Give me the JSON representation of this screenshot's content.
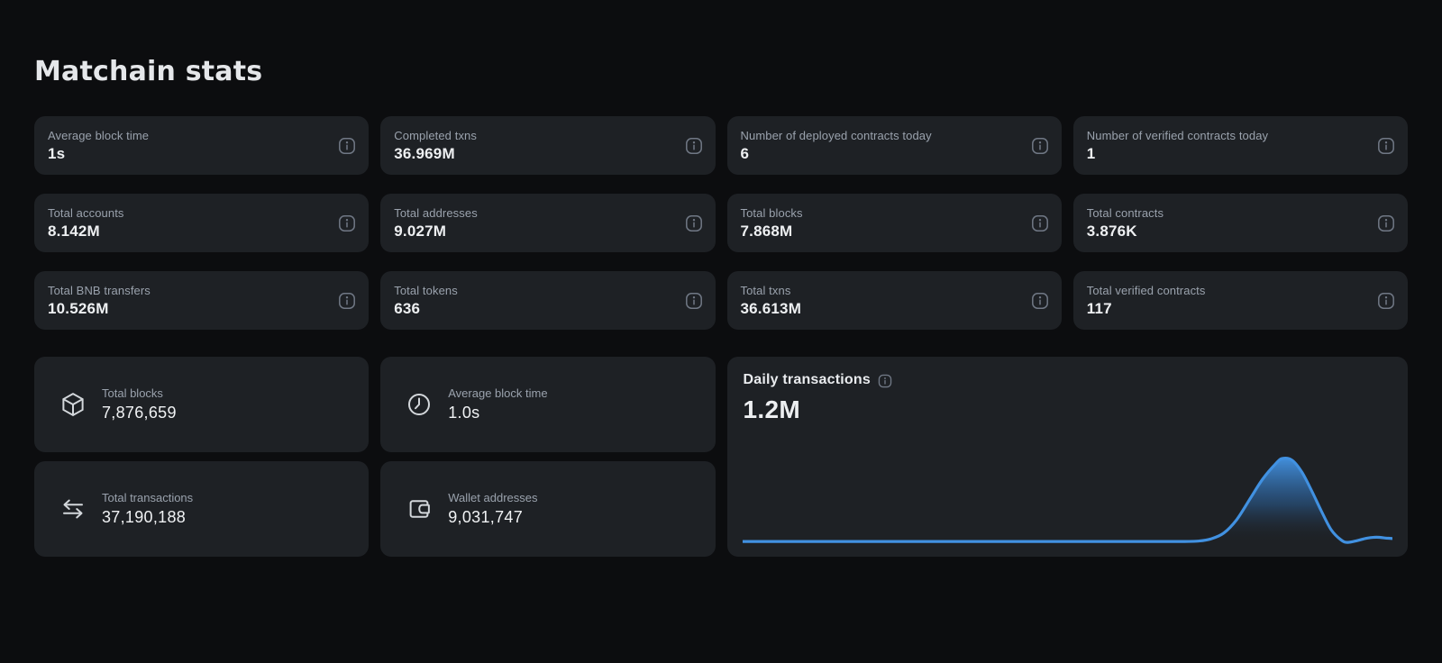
{
  "page": {
    "title": "Matchain stats"
  },
  "colors": {
    "background": "#0c0d0f",
    "card": "#1e2125",
    "accent_blue": "#4191e1",
    "label_gray": "#9aa2ad",
    "value_white": "#eef0f2"
  },
  "stat_cards": [
    {
      "label": "Average block time",
      "value": "1s"
    },
    {
      "label": "Completed txns",
      "value": "36.969M"
    },
    {
      "label": "Number of deployed contracts today",
      "value": "6"
    },
    {
      "label": "Number of verified contracts today",
      "value": "1"
    },
    {
      "label": "Total accounts",
      "value": "8.142M"
    },
    {
      "label": "Total addresses",
      "value": "9.027M"
    },
    {
      "label": "Total blocks",
      "value": "7.868M"
    },
    {
      "label": "Total contracts",
      "value": "3.876K"
    },
    {
      "label": "Total BNB transfers",
      "value": "10.526M"
    },
    {
      "label": "Total tokens",
      "value": "636"
    },
    {
      "label": "Total txns",
      "value": "36.613M"
    },
    {
      "label": "Total verified contracts",
      "value": "117"
    }
  ],
  "big_cards": [
    {
      "icon": "cube-icon",
      "label": "Total blocks",
      "value": "7,876,659"
    },
    {
      "icon": "clock-icon",
      "label": "Average block time",
      "value": "1.0s"
    },
    {
      "icon": "swap-arrows-icon",
      "label": "Total transactions",
      "value": "37,190,188"
    },
    {
      "icon": "wallet-icon",
      "label": "Wallet addresses",
      "value": "9,031,747"
    }
  ],
  "daily_transactions": {
    "title": "Daily transactions",
    "value": "1.2M"
  },
  "chart_data": {
    "type": "area",
    "title": "Daily transactions",
    "current_value_label": "1.2M",
    "xlabel": "",
    "ylabel": "",
    "axes_visible": false,
    "grid": false,
    "legend": false,
    "line_color": "#4191e1",
    "fill": "vertical gradient blue to transparent",
    "description": "Daily transaction count over time: flat near baseline for ~70% of range, sharp spike peaking at ~83% of width, falling back with a small secondary bump near the right edge; latest value 1.2M",
    "points": [
      [
        0,
        2
      ],
      [
        10,
        2
      ],
      [
        20,
        2
      ],
      [
        30,
        2
      ],
      [
        40,
        2
      ],
      [
        50,
        2
      ],
      [
        60,
        2
      ],
      [
        65,
        2
      ],
      [
        68,
        2
      ],
      [
        70,
        2.5
      ],
      [
        72,
        5
      ],
      [
        74,
        12
      ],
      [
        76,
        28
      ],
      [
        78,
        52
      ],
      [
        80,
        76
      ],
      [
        82,
        94
      ],
      [
        83,
        100
      ],
      [
        84.5,
        98
      ],
      [
        86,
        84
      ],
      [
        87.5,
        62
      ],
      [
        89,
        38
      ],
      [
        90.5,
        16
      ],
      [
        92,
        4
      ],
      [
        93,
        1
      ],
      [
        94.5,
        3
      ],
      [
        96,
        6
      ],
      [
        97.5,
        7
      ],
      [
        99,
        6
      ],
      [
        100,
        5.5
      ]
    ]
  }
}
